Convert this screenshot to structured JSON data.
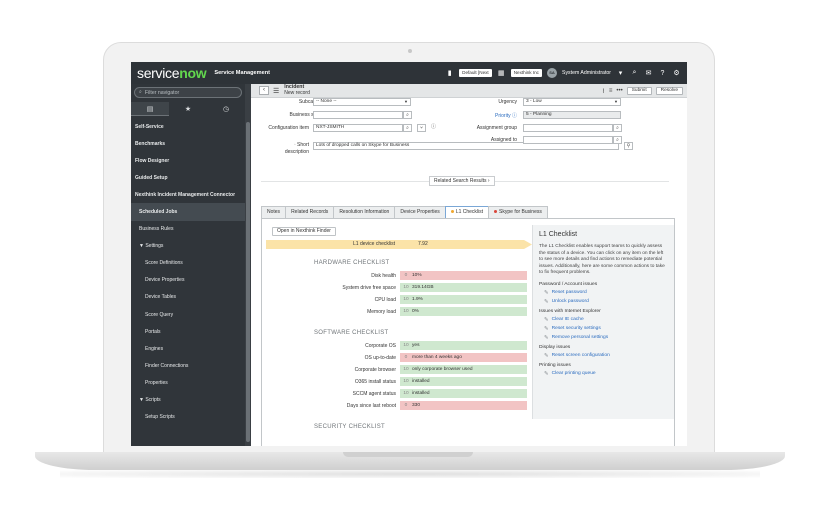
{
  "header": {
    "logo_service": "service",
    "logo_now": "now",
    "app_title": "Service Management",
    "update_set": "Default [Next",
    "domain": "Nexthink Inc",
    "avatar_initials": "SA",
    "user": "System Administrator"
  },
  "sidebar": {
    "filter_placeholder": "Filter navigator",
    "items": [
      {
        "label": "Self-Service",
        "level": "app"
      },
      {
        "label": "Benchmarks",
        "level": "app"
      },
      {
        "label": "Flow Designer",
        "level": "app"
      },
      {
        "label": "Guided Setup",
        "level": "app"
      },
      {
        "label": "Nexthink Incident Management Connector",
        "level": "app"
      },
      {
        "label": "Scheduled Jobs",
        "level": "mod",
        "selected": true
      },
      {
        "label": "Business Rules",
        "level": "mod"
      },
      {
        "label": "▼ Settings",
        "level": "mod"
      },
      {
        "label": "Score Definitions",
        "level": "sub"
      },
      {
        "label": "Device Properties",
        "level": "sub"
      },
      {
        "label": "Device Tables",
        "level": "sub"
      },
      {
        "label": "Score Query",
        "level": "sub"
      },
      {
        "label": "Portals",
        "level": "sub"
      },
      {
        "label": "Engines",
        "level": "sub"
      },
      {
        "label": "Finder Connections",
        "level": "sub"
      },
      {
        "label": "Properties",
        "level": "sub"
      },
      {
        "label": "▼ Scripts",
        "level": "mod"
      },
      {
        "label": "Setup Scripts",
        "level": "deep"
      }
    ]
  },
  "form_header": {
    "record_type": "Incident",
    "record_state": "New record",
    "submit": "Submit",
    "resolve": "Resolve"
  },
  "fields": {
    "subcategory_label": "Subcategory",
    "subcategory_value": "-- None --",
    "business_service_label": "Business service",
    "business_service_value": "",
    "configuration_item_label": "Configuration item",
    "configuration_item_value": "NXT-JSMITH",
    "short_description_label_1": "Short",
    "short_description_label_2": "description",
    "short_description_value": "Lots of dropped calls on Skype for Business",
    "urgency_label": "Urgency",
    "urgency_value": "3 - Low",
    "priority_label": "Priority",
    "priority_value": "5 - Planning",
    "assignment_group_label": "Assignment group",
    "assignment_group_value": "",
    "assigned_to_label": "Assigned to",
    "assigned_to_value": ""
  },
  "related_search": "Related Search Results",
  "tabs": [
    "Notes",
    "Related Records",
    "Resolution Information",
    "Device Properties",
    "L1 Checklist",
    "Skype for Business"
  ],
  "checklist": {
    "open_button": "Open in Nexthink Finder",
    "device_label": "L1 device checklist",
    "device_score": "7.92",
    "hardware_title": "HARDWARE CHECKLIST",
    "hardware": [
      {
        "label": "Disk health",
        "score": "0",
        "value": "10%",
        "status": "red"
      },
      {
        "label": "System drive free space",
        "score": "10",
        "value": "319.14GB",
        "status": "green"
      },
      {
        "label": "CPU load",
        "score": "10",
        "value": "1.9%",
        "status": "green"
      },
      {
        "label": "Memory load",
        "score": "10",
        "value": "0%",
        "status": "green"
      }
    ],
    "software_title": "SOFTWARE CHECKLIST",
    "software": [
      {
        "label": "Corporate OS",
        "score": "10",
        "value": "yes",
        "status": "green"
      },
      {
        "label": "OS up-to-date",
        "score": "0",
        "value": "more than 4 weeks ago",
        "status": "red"
      },
      {
        "label": "Corporate browser",
        "score": "10",
        "value": "only corporate browser used",
        "status": "green"
      },
      {
        "label": "O365 install status",
        "score": "10",
        "value": "installed",
        "status": "green"
      },
      {
        "label": "SCCM agent status",
        "score": "10",
        "value": "installed",
        "status": "green"
      },
      {
        "label": "Days since last reboot",
        "score": "0",
        "value": "330",
        "status": "red"
      }
    ],
    "security_title": "SECURITY CHECKLIST"
  },
  "help": {
    "title": "L1 Checklist",
    "intro": "The L1 Checklist enables support teams to quickly assess the status of a device. You can click on any item on the left to see more details and find actions to remediate potential issues. Additionally, here are some common actions to take to fix frequent problems.",
    "groups": [
      {
        "title": "Password / Account issues",
        "links": [
          "Reset password",
          "Unlock password"
        ]
      },
      {
        "title": "Issues with Internet Explorer",
        "links": [
          "Clear IE cache",
          "Reset security settings",
          "Remove personal settings"
        ]
      },
      {
        "title": "Display issues",
        "links": [
          "Reset screen configuration"
        ]
      },
      {
        "title": "Printing issues",
        "links": [
          "Clear printing queue"
        ]
      }
    ]
  },
  "colors": {
    "topbar": "#2e3338",
    "sidebar": "#30353a",
    "brand_green": "#62d84e",
    "ok_green": "#cfe8cf",
    "bad_red": "#f2c4c4",
    "device_bar": "#fbe3a8",
    "link_blue": "#2a6bbf"
  }
}
